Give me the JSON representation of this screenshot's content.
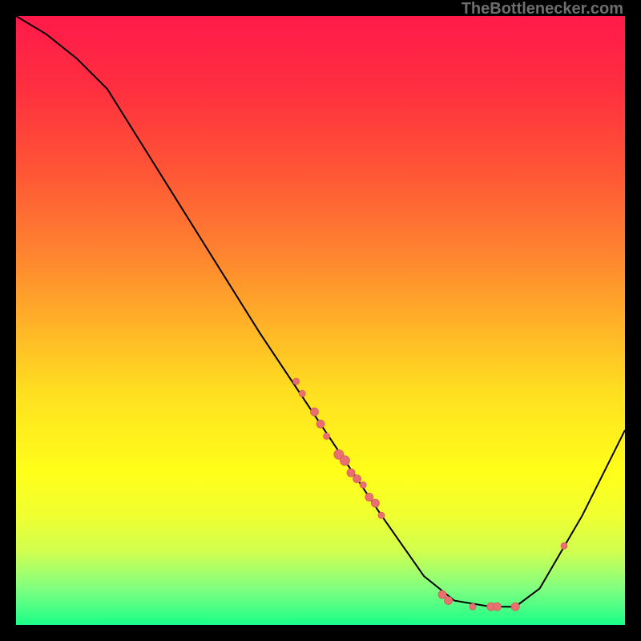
{
  "attribution": "TheBottlenecker.com",
  "chart_data": {
    "type": "line",
    "title": "",
    "xlabel": "",
    "ylabel": "",
    "xlim": [
      0,
      100
    ],
    "ylim": [
      0,
      100
    ],
    "curve": [
      {
        "x": 0,
        "y": 100
      },
      {
        "x": 5,
        "y": 97
      },
      {
        "x": 10,
        "y": 93
      },
      {
        "x": 15,
        "y": 88
      },
      {
        "x": 20,
        "y": 80
      },
      {
        "x": 30,
        "y": 64
      },
      {
        "x": 40,
        "y": 48
      },
      {
        "x": 50,
        "y": 33
      },
      {
        "x": 60,
        "y": 18
      },
      {
        "x": 67,
        "y": 8
      },
      {
        "x": 72,
        "y": 4
      },
      {
        "x": 78,
        "y": 3
      },
      {
        "x": 82,
        "y": 3
      },
      {
        "x": 86,
        "y": 6
      },
      {
        "x": 93,
        "y": 18
      },
      {
        "x": 100,
        "y": 32
      }
    ],
    "points_on_curve": [
      {
        "x": 46,
        "y": 40,
        "r": 4
      },
      {
        "x": 47,
        "y": 38,
        "r": 4
      },
      {
        "x": 49,
        "y": 35,
        "r": 5
      },
      {
        "x": 50,
        "y": 33,
        "r": 5
      },
      {
        "x": 51,
        "y": 31,
        "r": 4
      },
      {
        "x": 53,
        "y": 28,
        "r": 6
      },
      {
        "x": 54,
        "y": 27,
        "r": 6
      },
      {
        "x": 55,
        "y": 25,
        "r": 5
      },
      {
        "x": 56,
        "y": 24,
        "r": 5
      },
      {
        "x": 57,
        "y": 23,
        "r": 4
      },
      {
        "x": 58,
        "y": 21,
        "r": 5
      },
      {
        "x": 59,
        "y": 20,
        "r": 5
      },
      {
        "x": 60,
        "y": 18,
        "r": 4
      },
      {
        "x": 70,
        "y": 5,
        "r": 5
      },
      {
        "x": 71,
        "y": 4,
        "r": 5
      },
      {
        "x": 75,
        "y": 3,
        "r": 4
      },
      {
        "x": 78,
        "y": 3,
        "r": 5
      },
      {
        "x": 79,
        "y": 3,
        "r": 5
      },
      {
        "x": 82,
        "y": 3,
        "r": 5
      },
      {
        "x": 90,
        "y": 13,
        "r": 4
      }
    ],
    "colors": {
      "curve": "#000000",
      "points_fill": "#e97070",
      "points_stroke": "#d85a5a"
    }
  }
}
